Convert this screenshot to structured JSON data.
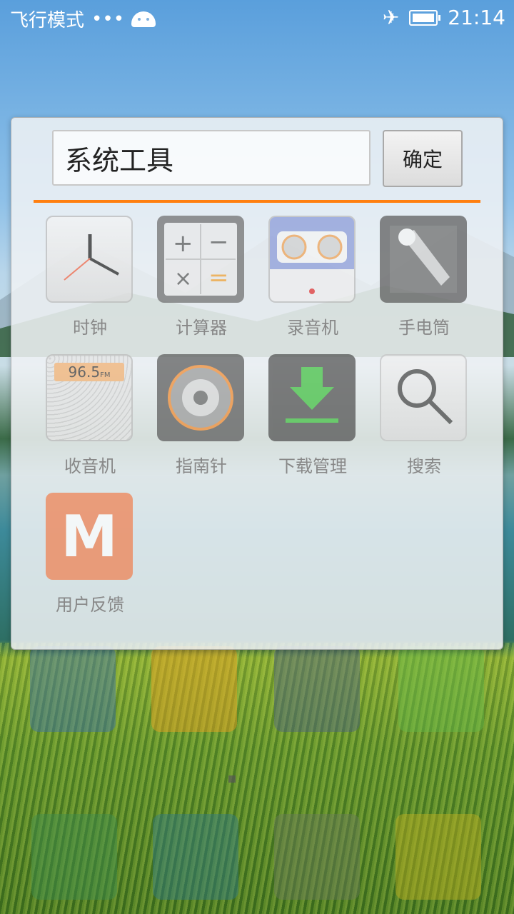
{
  "status_bar": {
    "mode": "飞行模式",
    "dots": "•••",
    "time": "21:14"
  },
  "folder": {
    "name_value": "系统工具",
    "confirm_label": "确定",
    "accent_color": "#ff7f10",
    "apps": [
      {
        "label": "时钟",
        "icon": "clock-icon"
      },
      {
        "label": "计算器",
        "icon": "calculator-icon"
      },
      {
        "label": "录音机",
        "icon": "recorder-icon"
      },
      {
        "label": "手电筒",
        "icon": "flashlight-icon"
      },
      {
        "label": "收音机",
        "icon": "radio-icon",
        "display": "96.5"
      },
      {
        "label": "指南针",
        "icon": "compass-icon"
      },
      {
        "label": "下载管理",
        "icon": "download-icon"
      },
      {
        "label": "搜索",
        "icon": "search-icon"
      },
      {
        "label": "用户反馈",
        "icon": "feedback-icon",
        "glyph": "M"
      }
    ]
  },
  "radio_display": {
    "FM": "FM"
  }
}
